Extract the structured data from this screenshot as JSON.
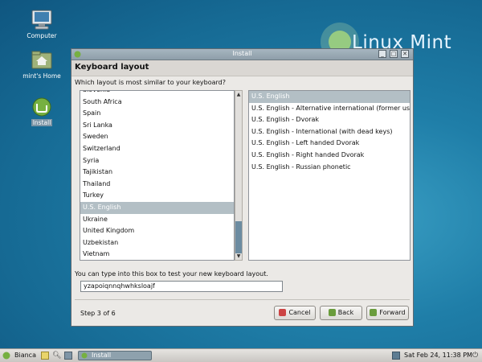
{
  "desktop": {
    "icons": [
      {
        "label": "Computer"
      },
      {
        "label": "mint's Home"
      },
      {
        "label": "Install"
      }
    ],
    "brand": "Linux Mint"
  },
  "window": {
    "title": "Install",
    "heading": "Keyboard layout",
    "question": "Which layout is most similar to your keyboard?",
    "countries": [
      "Slovenia",
      "South Africa",
      "Spain",
      "Sri Lanka",
      "Sweden",
      "Switzerland",
      "Syria",
      "Tajikistan",
      "Thailand",
      "Turkey",
      "U.S. English",
      "Ukraine",
      "United Kingdom",
      "Uzbekistan",
      "Vietnam"
    ],
    "selected_country": "U.S. English",
    "variants": [
      "U.S. English",
      "U.S. English - Alternative international (former us_int",
      "U.S. English - Dvorak",
      "U.S. English - International (with dead keys)",
      "U.S. English - Left handed Dvorak",
      "U.S. English - Right handed Dvorak",
      "U.S. English - Russian phonetic"
    ],
    "selected_variant": "U.S. English",
    "test_hint": "You can type into this box to test your new keyboard layout.",
    "test_value": "yzapoiqnnqhwhksloajf",
    "step": "Step 3 of 6",
    "buttons": {
      "cancel": "Cancel",
      "back": "Back",
      "forward": "Forward"
    }
  },
  "taskbar": {
    "user": "Bianca",
    "task_label": "Install",
    "clock": "Sat Feb 24, 11:38 PM"
  },
  "colors": {
    "accent": "#6c8ca1",
    "selection": "#b3bfc5",
    "mint_green": "#76b041"
  }
}
